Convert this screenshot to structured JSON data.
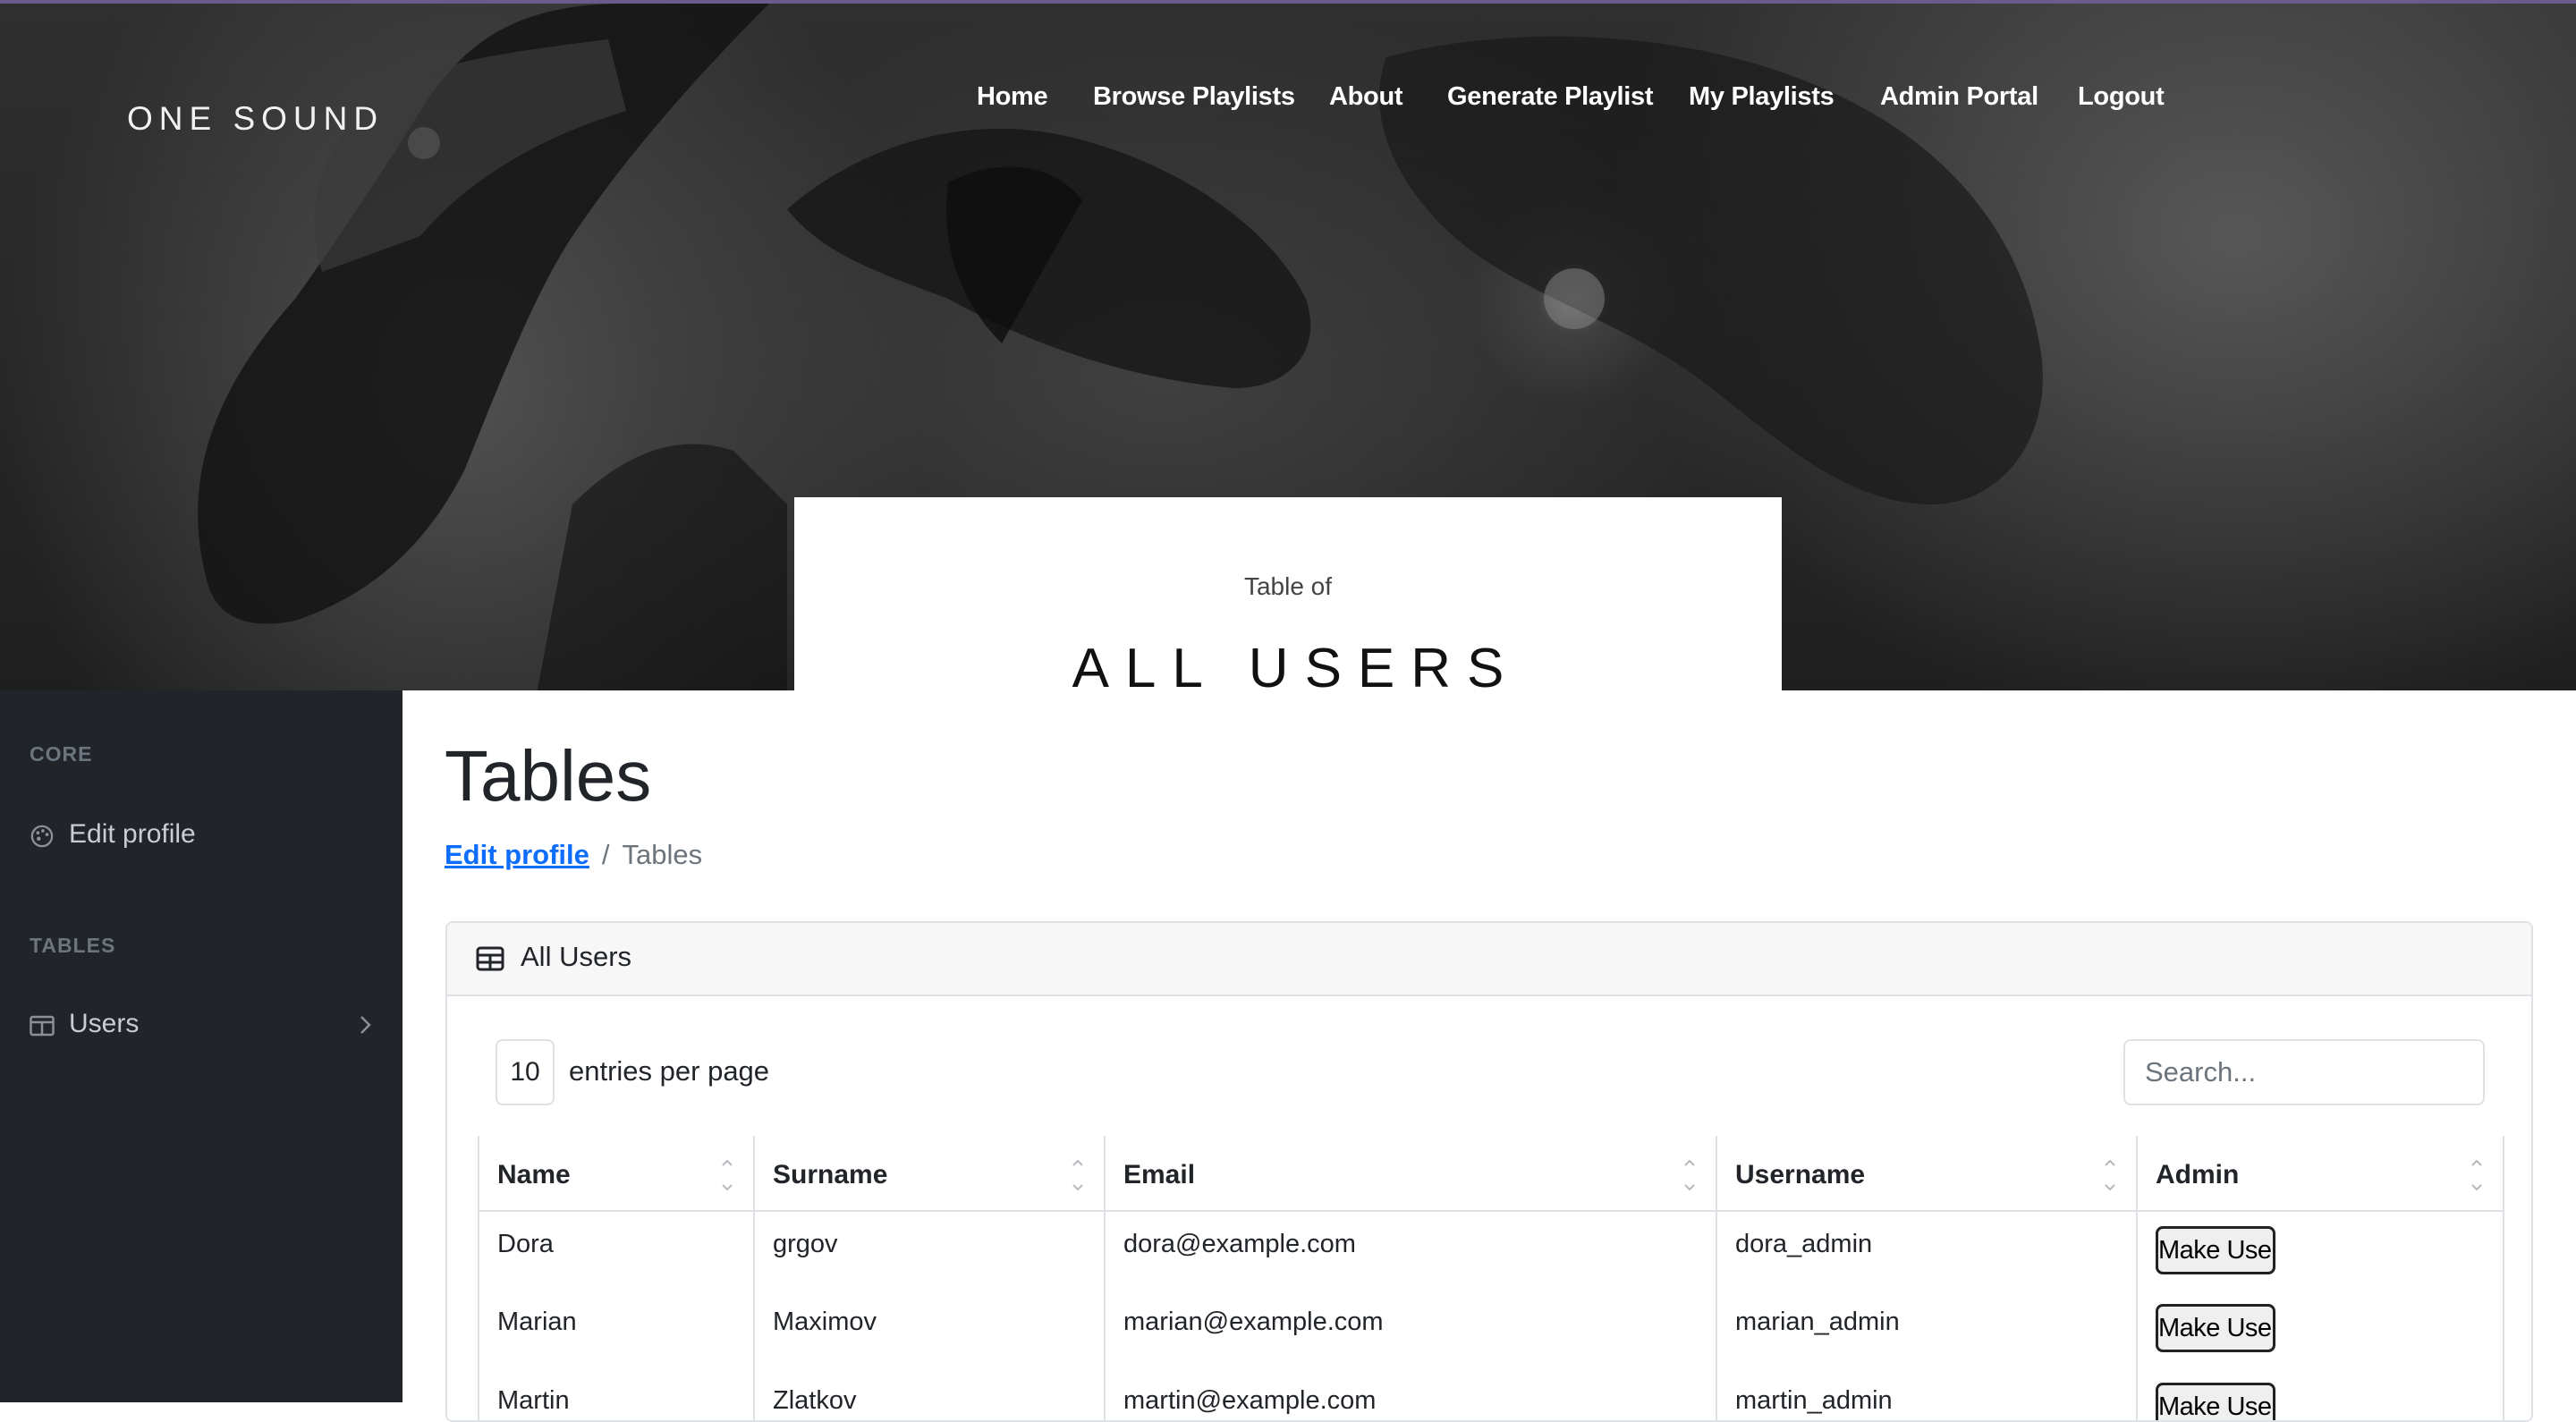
{
  "brand": {
    "logo_text": "ONE SOUND"
  },
  "nav": {
    "items": [
      {
        "label": "Home"
      },
      {
        "label": "Browse Playlists"
      },
      {
        "label": "About"
      },
      {
        "label": "Generate Playlist"
      },
      {
        "label": "My Playlists"
      },
      {
        "label": "Admin Portal"
      },
      {
        "label": "Logout"
      }
    ]
  },
  "hero": {
    "subtitle": "Table of",
    "title": "ALL USERS"
  },
  "sidebar": {
    "sections": [
      {
        "heading": "CORE",
        "items": [
          {
            "label": "Edit profile",
            "icon": "palette-icon"
          }
        ]
      },
      {
        "heading": "TABLES",
        "items": [
          {
            "label": "Users",
            "icon": "columns-icon",
            "has_chevron": true
          }
        ]
      }
    ]
  },
  "page": {
    "title": "Tables",
    "breadcrumb": {
      "link": "Edit profile",
      "separator": "/",
      "current": "Tables"
    }
  },
  "card": {
    "header_label": "All Users",
    "header_icon": "table-icon",
    "per_page_value": "10",
    "per_page_label": "entries per page",
    "search_placeholder": "Search...",
    "columns": [
      "Name",
      "Surname",
      "Email",
      "Username",
      "Admin"
    ],
    "rows": [
      {
        "name": "Dora",
        "surname": "grgov",
        "email": "dora@example.com",
        "username": "dora_admin",
        "action": "Make User"
      },
      {
        "name": "Marian",
        "surname": "Maximov",
        "email": "marian@example.com",
        "username": "marian_admin",
        "action": "Make User"
      },
      {
        "name": "Martin",
        "surname": "Zlatkov",
        "email": "martin@example.com",
        "username": "martin_admin",
        "action": "Make User"
      }
    ]
  },
  "colors": {
    "sidebar_bg": "#212529",
    "link_blue": "#0d6efd",
    "muted": "#6c757d",
    "hero_top_border": "#6b5a8a"
  }
}
